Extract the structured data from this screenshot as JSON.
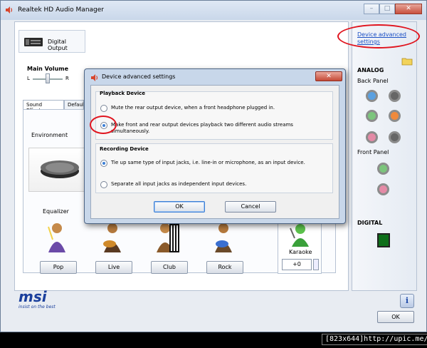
{
  "window": {
    "title": "Realtek HD Audio Manager"
  },
  "device_tab": {
    "label": "Digital Output"
  },
  "advanced_link": {
    "label": "Device advanced settings"
  },
  "main_volume": {
    "label": "Main Volume",
    "left": "L",
    "right": "R",
    "level": 0.5
  },
  "tabs": [
    {
      "label": "Sound Effects"
    },
    {
      "label": "Default"
    }
  ],
  "environment": {
    "label": "Environment"
  },
  "equalizer": {
    "label": "Equalizer",
    "presets": [
      {
        "label": "Pop"
      },
      {
        "label": "Live"
      },
      {
        "label": "Club"
      },
      {
        "label": "Rock"
      }
    ]
  },
  "karaoke": {
    "label": "Karaoke",
    "value": "+0"
  },
  "right_panel": {
    "analog_title": "ANALOG",
    "back_panel_label": "Back Panel",
    "front_panel_label": "Front Panel",
    "digital_title": "DIGITAL",
    "back_jacks": [
      "#5aa0e0",
      "#666666",
      "#7cc57c",
      "#f08a3c",
      "#e48aa6",
      "#666666"
    ],
    "front_jacks": [
      "#7cc57c",
      "#e48aa6"
    ]
  },
  "brand": {
    "name": "msi",
    "tagline": "insist on the best"
  },
  "info_label": "i",
  "ok_label": "OK",
  "dialog": {
    "title": "Device advanced settings",
    "playback": {
      "title": "Playback Device",
      "options": [
        {
          "label": "Mute the rear output device, when a front headphone plugged in.",
          "selected": false
        },
        {
          "label": "Make front and rear output devices playback two different audio streams simultaneously.",
          "selected": true
        }
      ]
    },
    "recording": {
      "title": "Recording Device",
      "options": [
        {
          "label": "Tie up same type of input jacks, i.e. line-in or microphone, as an input device.",
          "selected": true
        },
        {
          "label": "Separate all input jacks as independent input devices.",
          "selected": false
        }
      ]
    },
    "ok_label": "OK",
    "cancel_label": "Cancel"
  },
  "watermark": "[823x644]http://upic.me/"
}
